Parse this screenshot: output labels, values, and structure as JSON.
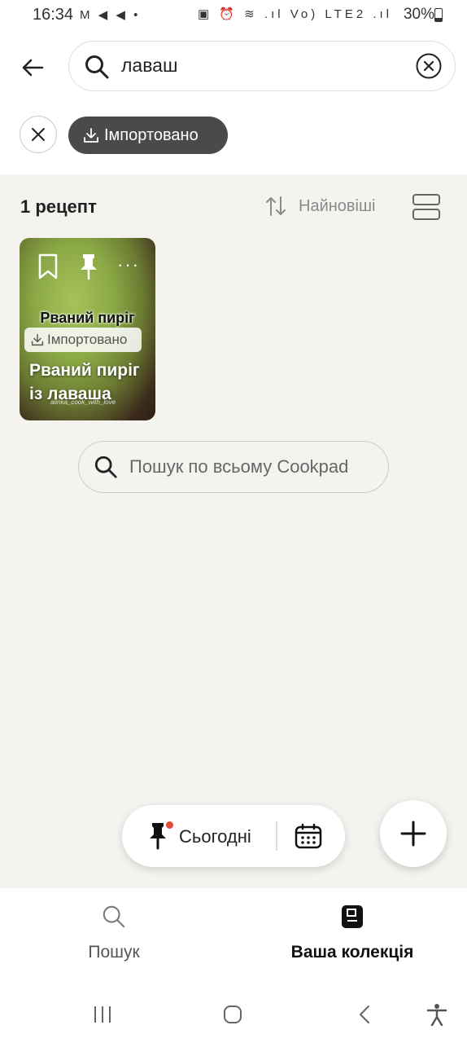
{
  "status_bar": {
    "time": "16:34",
    "left_icons": "M ◀ ◀ •",
    "right_icons": "▣ ⏰ ≋ .ıl Vo) LTE2 .ıl",
    "battery": "30%"
  },
  "search": {
    "value": "лаваш"
  },
  "filters": {
    "imported_chip": "Імпортовано"
  },
  "results": {
    "count": "1 рецепт",
    "sort_label": "Найновіші"
  },
  "recipe_card": {
    "overlay_title": "Рваний пиріг",
    "badge": "Імпортовано",
    "title": "Рваний пиріг із лаваша",
    "watermark": "alinka_cook_with_love",
    "more": "···"
  },
  "global_search": {
    "label": "Пошук по всьому Cookpad"
  },
  "today_widget": {
    "label": "Сьогодні"
  },
  "bottom_nav": {
    "search_label": "Пошук",
    "collection_label": "Ваша колекція"
  },
  "colors": {
    "chip_bg": "#4a4a4a",
    "background": "#f5f3ef",
    "notification_dot": "#e24b3a"
  }
}
